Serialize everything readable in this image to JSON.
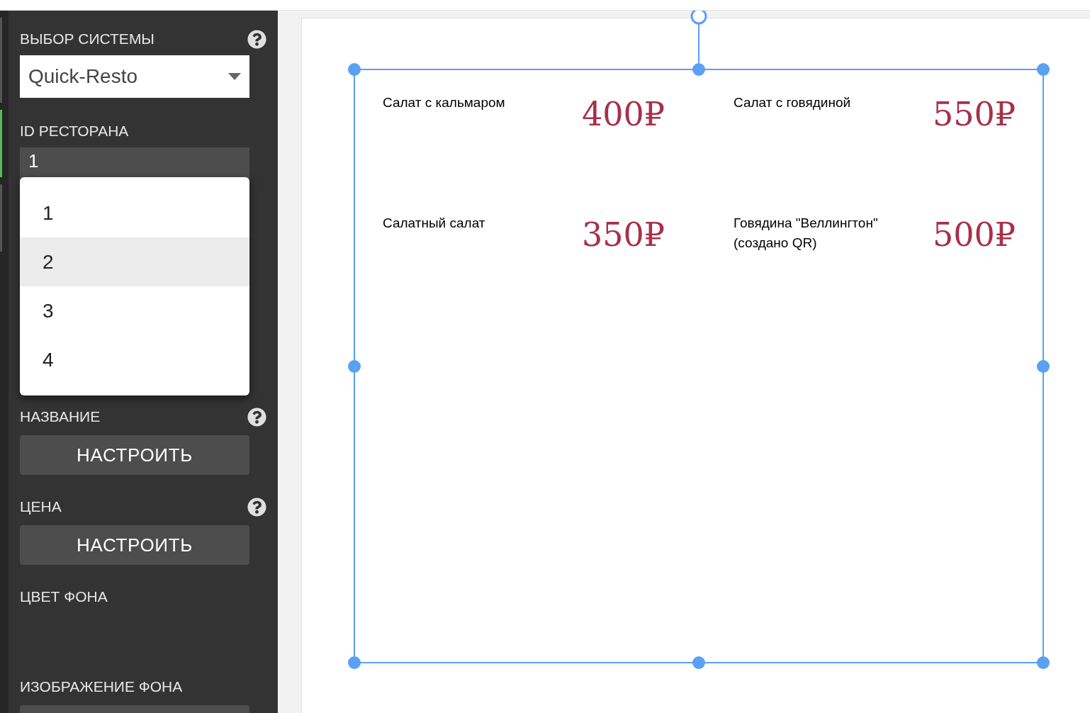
{
  "sidebar": {
    "system": {
      "label": "ВЫБОР СИСТЕМЫ",
      "value": "Quick-Resto"
    },
    "restaurant_id": {
      "label": "ID РЕСТОРАНА",
      "value": "1",
      "dropdown": {
        "open": true,
        "options": [
          {
            "label": "1",
            "highlighted": false
          },
          {
            "label": "2",
            "highlighted": true
          },
          {
            "label": "3",
            "highlighted": false
          },
          {
            "label": "4",
            "highlighted": false
          }
        ]
      }
    },
    "sections": [
      {
        "kind": "button",
        "label": "НАЗВАНИЕ",
        "help": true,
        "button": "НАСТРОИТЬ"
      },
      {
        "kind": "button",
        "label": "ЦЕНА",
        "help": true,
        "button": "НАСТРОИТЬ"
      },
      {
        "kind": "color",
        "label": "ЦВЕТ ФОНА",
        "help": false
      },
      {
        "kind": "image",
        "label": "ИЗОБРАЖЕНИЕ ФОНА",
        "help": false
      }
    ]
  },
  "canvas": {
    "selected": true,
    "menu_items": [
      {
        "name": "Салат с кальмаром",
        "price": "400₽"
      },
      {
        "name": "Салат с говядиной",
        "price": "550₽"
      },
      {
        "name": "Салатный салат",
        "price": "350₽"
      },
      {
        "name": "Говядина \"Веллингтон\" (создано QR)",
        "price": "500₽"
      }
    ]
  }
}
